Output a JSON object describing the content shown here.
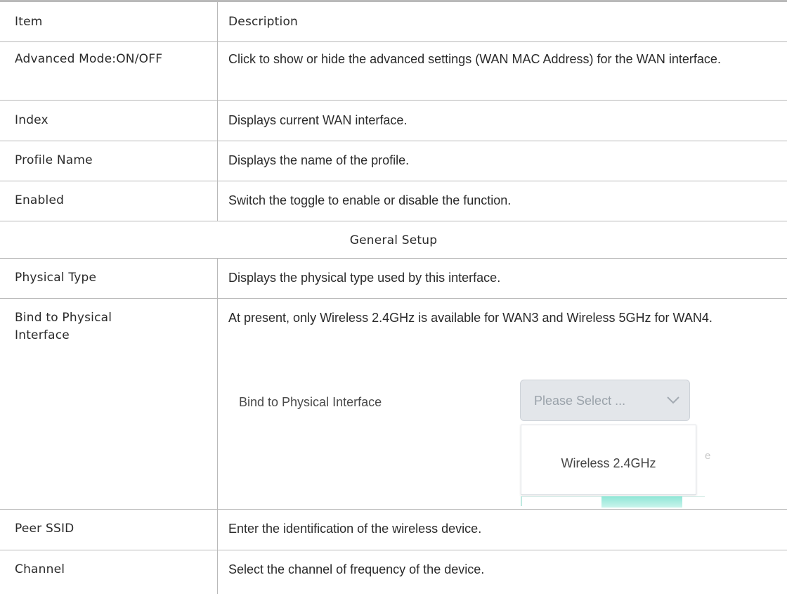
{
  "table": {
    "header": {
      "item": "Item",
      "description": "Description"
    },
    "rows": [
      {
        "item": "Advanced Mode:ON/OFF",
        "description": "Click to show or hide the advanced settings (WAN MAC Address) for the WAN interface."
      },
      {
        "item": "Index",
        "description": "Displays current WAN interface."
      },
      {
        "item": "Profile Name",
        "description": "Displays the name of the profile."
      },
      {
        "item": "Enabled",
        "description": "Switch the toggle to enable or disable the function."
      }
    ],
    "section_title": "General Setup",
    "section_rows": [
      {
        "item": "Physical Type",
        "description": "Displays the physical type used by this interface."
      },
      {
        "item": "Bind to Physical Interface",
        "description": "At present, only Wireless 2.4GHz is available for WAN3 and Wireless 5GHz for WAN4."
      },
      {
        "item": "Peer SSID",
        "description": "Enter the identification of the wireless device."
      },
      {
        "item": "Channel",
        "description": "Select the channel of frequency of the device."
      }
    ]
  },
  "snippet": {
    "label": "Bind to Physical Interface",
    "select_placeholder": "Please Select ...",
    "chevron_icon": "chevron-down-icon",
    "options": [
      "Wireless 2.4GHz"
    ],
    "partial_char": "e",
    "colors": {
      "select_bg": "#e3e6ea",
      "accent": "#8fe6d6"
    }
  }
}
